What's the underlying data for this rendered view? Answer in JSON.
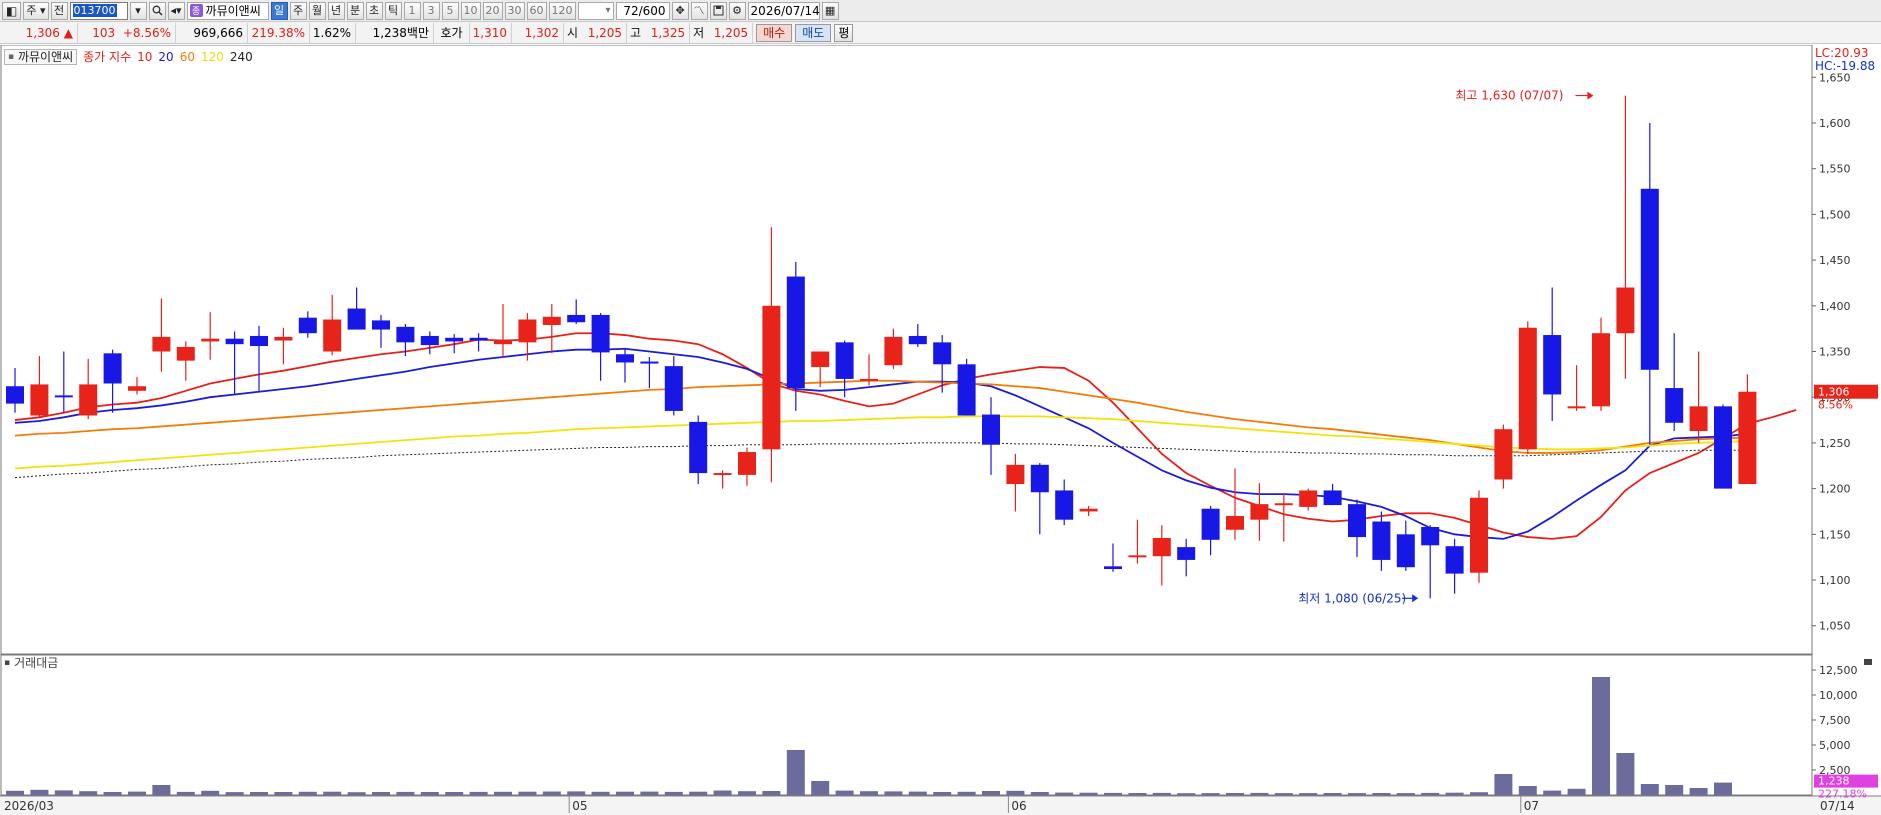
{
  "toolbar": {
    "market": "주",
    "jeon": "전",
    "stock_code": "013700",
    "stock_name": "까뮤이앤씨",
    "stock_badge": "종",
    "periods": [
      "일",
      "주",
      "월",
      "년",
      "분",
      "초",
      "틱"
    ],
    "active_period": "일",
    "intervals": [
      "1",
      "3",
      "5",
      "10",
      "20",
      "30",
      "60",
      "120"
    ],
    "count": "72",
    "count_total": "/600",
    "date": "2026/07/14"
  },
  "quote": {
    "price": "1,306",
    "change_arrow": "▲",
    "change": "103",
    "change_pct": "+8.56%",
    "volume": "969,666",
    "volume_ratio": "219.38%",
    "turnover": "1.62%",
    "amount": "1,238백만",
    "bid_label": "호가",
    "ask_price": "1,310",
    "bid_price": "1,302",
    "open_label": "시",
    "open": "1,205",
    "high_label": "고",
    "high": "1,325",
    "low_label": "저",
    "low": "1,205",
    "buy_label": "매수",
    "sell_label": "매도",
    "eval_label": "평"
  },
  "legend": {
    "name": "까뮤이앤씨",
    "ma_label": "종가 지수",
    "ma_periods": [
      "10",
      "20",
      "60",
      "120",
      "240"
    ],
    "ma_colors": [
      "#e8201a",
      "#1c1cd6",
      "#f07d0a",
      "#f2e30c",
      "#222222"
    ],
    "volume_label": "거래대금"
  },
  "colors": {
    "up": "#e8231a",
    "down": "#1717e6",
    "volume": "#6c6c9c",
    "price_tag": "#e8231a",
    "volume_tag": "#e040e0"
  },
  "chart_data": {
    "type": "candlestick",
    "x_tick_labels": [
      "2026/03",
      "05",
      "06",
      "07",
      "07/14"
    ],
    "y_ticks": [
      "1,650",
      "1,600",
      "1,550",
      "1,500",
      "1,450",
      "1,400",
      "1,350",
      "1,300",
      "1,250",
      "1,200",
      "1,150",
      "1,100",
      "1,050"
    ],
    "y_range": [
      1030,
      1670
    ],
    "volume_ticks": [
      "12,500",
      "10,000",
      "7,500",
      "5,000",
      "2,500"
    ],
    "volume_range": [
      0,
      13000
    ],
    "lc_label": "LC:20.93",
    "hc_label": "HC:-19.88",
    "high_annotation": "최고 1,630 (07/07)",
    "low_annotation": "최저 1,080 (06/25)",
    "current_price_tag": "1,306",
    "current_change_tag": "8.56%",
    "volume_tag": "1,238",
    "volume_pct_tag": "227.18%",
    "candles": [
      {
        "o": 1312,
        "h": 1332,
        "l": 1283,
        "c": 1293
      },
      {
        "o": 1280,
        "h": 1345,
        "l": 1277,
        "c": 1314
      },
      {
        "o": 1302,
        "h": 1350,
        "l": 1283,
        "c": 1300
      },
      {
        "o": 1280,
        "h": 1342,
        "l": 1276,
        "c": 1314
      },
      {
        "o": 1348,
        "h": 1352,
        "l": 1283,
        "c": 1315
      },
      {
        "o": 1307,
        "h": 1322,
        "l": 1303,
        "c": 1312
      },
      {
        "o": 1350,
        "h": 1408,
        "l": 1328,
        "c": 1366
      },
      {
        "o": 1340,
        "h": 1361,
        "l": 1318,
        "c": 1355
      },
      {
        "o": 1361,
        "h": 1393,
        "l": 1341,
        "c": 1364
      },
      {
        "o": 1364,
        "h": 1372,
        "l": 1303,
        "c": 1358
      },
      {
        "o": 1367,
        "h": 1378,
        "l": 1307,
        "c": 1356
      },
      {
        "o": 1362,
        "h": 1376,
        "l": 1336,
        "c": 1366
      },
      {
        "o": 1387,
        "h": 1394,
        "l": 1365,
        "c": 1370
      },
      {
        "o": 1350,
        "h": 1412,
        "l": 1346,
        "c": 1385
      },
      {
        "o": 1397,
        "h": 1420,
        "l": 1377,
        "c": 1374
      },
      {
        "o": 1384,
        "h": 1390,
        "l": 1354,
        "c": 1374
      },
      {
        "o": 1377,
        "h": 1380,
        "l": 1345,
        "c": 1360
      },
      {
        "o": 1367,
        "h": 1372,
        "l": 1347,
        "c": 1357
      },
      {
        "o": 1365,
        "h": 1369,
        "l": 1348,
        "c": 1361
      },
      {
        "o": 1365,
        "h": 1370,
        "l": 1350,
        "c": 1362
      },
      {
        "o": 1358,
        "h": 1402,
        "l": 1343,
        "c": 1362
      },
      {
        "o": 1360,
        "h": 1392,
        "l": 1340,
        "c": 1385
      },
      {
        "o": 1379,
        "h": 1402,
        "l": 1348,
        "c": 1388
      },
      {
        "o": 1390,
        "h": 1407,
        "l": 1380,
        "c": 1382
      },
      {
        "o": 1390,
        "h": 1392,
        "l": 1318,
        "c": 1349
      },
      {
        "o": 1347,
        "h": 1353,
        "l": 1316,
        "c": 1338
      },
      {
        "o": 1339,
        "h": 1344,
        "l": 1310,
        "c": 1338
      },
      {
        "o": 1334,
        "h": 1345,
        "l": 1280,
        "c": 1285
      },
      {
        "o": 1273,
        "h": 1280,
        "l": 1205,
        "c": 1217
      },
      {
        "o": 1217,
        "h": 1220,
        "l": 1200,
        "c": 1217
      },
      {
        "o": 1215,
        "h": 1245,
        "l": 1203,
        "c": 1240
      },
      {
        "o": 1243,
        "h": 1486,
        "l": 1207,
        "c": 1400
      },
      {
        "o": 1432,
        "h": 1448,
        "l": 1285,
        "c": 1310
      },
      {
        "o": 1333,
        "h": 1348,
        "l": 1311,
        "c": 1350
      },
      {
        "o": 1360,
        "h": 1362,
        "l": 1300,
        "c": 1320
      },
      {
        "o": 1318,
        "h": 1347,
        "l": 1313,
        "c": 1320
      },
      {
        "o": 1335,
        "h": 1375,
        "l": 1331,
        "c": 1366
      },
      {
        "o": 1367,
        "h": 1380,
        "l": 1355,
        "c": 1358
      },
      {
        "o": 1360,
        "h": 1368,
        "l": 1305,
        "c": 1336
      },
      {
        "o": 1336,
        "h": 1342,
        "l": 1280,
        "c": 1280
      },
      {
        "o": 1281,
        "h": 1300,
        "l": 1215,
        "c": 1248
      },
      {
        "o": 1205,
        "h": 1238,
        "l": 1175,
        "c": 1226
      },
      {
        "o": 1226,
        "h": 1228,
        "l": 1150,
        "c": 1196
      },
      {
        "o": 1198,
        "h": 1210,
        "l": 1160,
        "c": 1166
      },
      {
        "o": 1175,
        "h": 1181,
        "l": 1170,
        "c": 1178
      },
      {
        "o": 1115,
        "h": 1140,
        "l": 1109,
        "c": 1112
      },
      {
        "o": 1125,
        "h": 1166,
        "l": 1118,
        "c": 1127
      },
      {
        "o": 1126,
        "h": 1160,
        "l": 1094,
        "c": 1146
      },
      {
        "o": 1136,
        "h": 1145,
        "l": 1104,
        "c": 1122
      },
      {
        "o": 1178,
        "h": 1181,
        "l": 1127,
        "c": 1144
      },
      {
        "o": 1155,
        "h": 1222,
        "l": 1144,
        "c": 1170
      },
      {
        "o": 1166,
        "h": 1206,
        "l": 1143,
        "c": 1183
      },
      {
        "o": 1183,
        "h": 1195,
        "l": 1142,
        "c": 1184
      },
      {
        "o": 1180,
        "h": 1200,
        "l": 1176,
        "c": 1198
      },
      {
        "o": 1198,
        "h": 1205,
        "l": 1183,
        "c": 1182
      },
      {
        "o": 1183,
        "h": 1188,
        "l": 1125,
        "c": 1147
      },
      {
        "o": 1164,
        "h": 1175,
        "l": 1110,
        "c": 1122
      },
      {
        "o": 1150,
        "h": 1165,
        "l": 1110,
        "c": 1114
      },
      {
        "o": 1158,
        "h": 1160,
        "l": 1080,
        "c": 1138
      },
      {
        "o": 1137,
        "h": 1145,
        "l": 1085,
        "c": 1107
      },
      {
        "o": 1108,
        "h": 1198,
        "l": 1097,
        "c": 1190
      },
      {
        "o": 1210,
        "h": 1270,
        "l": 1200,
        "c": 1265
      },
      {
        "o": 1243,
        "h": 1383,
        "l": 1238,
        "c": 1376
      },
      {
        "o": 1368,
        "h": 1420,
        "l": 1274,
        "c": 1303
      },
      {
        "o": 1290,
        "h": 1335,
        "l": 1285,
        "c": 1290
      },
      {
        "o": 1290,
        "h": 1387,
        "l": 1285,
        "c": 1370
      },
      {
        "o": 1370,
        "h": 1630,
        "l": 1320,
        "c": 1420
      },
      {
        "o": 1528,
        "h": 1600,
        "l": 1248,
        "c": 1330
      },
      {
        "o": 1310,
        "h": 1370,
        "l": 1263,
        "c": 1272
      },
      {
        "o": 1263,
        "h": 1350,
        "l": 1250,
        "c": 1290
      },
      {
        "o": 1290,
        "h": 1292,
        "l": 1200,
        "c": 1200
      },
      {
        "o": 1205,
        "h": 1325,
        "l": 1205,
        "c": 1306
      }
    ],
    "volume": [
      420,
      520,
      460,
      380,
      300,
      340,
      1000,
      310,
      420,
      290,
      300,
      300,
      320,
      330,
      280,
      300,
      310,
      300,
      300,
      310,
      320,
      330,
      350,
      360,
      320,
      330,
      340,
      310,
      330,
      450,
      380,
      400,
      4500,
      1400,
      440,
      380,
      360,
      340,
      300,
      320,
      400,
      420,
      300,
      240,
      230,
      210,
      200,
      210,
      180,
      190,
      200,
      210,
      190,
      190,
      200,
      190,
      200,
      190,
      210,
      230,
      280,
      2100,
      900,
      440,
      620,
      11800,
      4200,
      1100,
      1000,
      700,
      1238
    ],
    "ma_series": [
      {
        "name": "10",
        "values": [
          1275,
          1278,
          1283,
          1289,
          1292,
          1294,
          1299,
          1307,
          1315,
          1320,
          1325,
          1329,
          1334,
          1339,
          1343,
          1347,
          1350,
          1354,
          1358,
          1363,
          1362,
          1363,
          1366,
          1370,
          1370,
          1368,
          1364,
          1362,
          1358,
          1347,
          1332,
          1315,
          1307,
          1303,
          1296,
          1290,
          1293,
          1303,
          1313,
          1320,
          1325,
          1329,
          1333,
          1332,
          1318,
          1294,
          1266,
          1238,
          1217,
          1203,
          1190,
          1181,
          1172,
          1167,
          1164,
          1166,
          1170,
          1173,
          1173,
          1168,
          1160,
          1152,
          1147,
          1145,
          1148,
          1169,
          1198,
          1217,
          1228,
          1239,
          1255,
          1271,
          1278,
          1286
        ]
      },
      {
        "name": "20",
        "values": [
          1272,
          1274,
          1278,
          1283,
          1286,
          1288,
          1291,
          1295,
          1300,
          1303,
          1306,
          1309,
          1312,
          1316,
          1320,
          1324,
          1328,
          1333,
          1337,
          1341,
          1344,
          1347,
          1350,
          1352,
          1352,
          1353,
          1350,
          1347,
          1344,
          1338,
          1331,
          1320,
          1309,
          1307,
          1308,
          1311,
          1314,
          1317,
          1317,
          1316,
          1312,
          1302,
          1290,
          1278,
          1266,
          1250,
          1235,
          1220,
          1209,
          1201,
          1196,
          1194,
          1194,
          1193,
          1191,
          1186,
          1180,
          1170,
          1157,
          1150,
          1147,
          1145,
          1153,
          1169,
          1187,
          1204,
          1220,
          1247,
          1255,
          1256,
          1257,
          1260
        ]
      },
      {
        "name": "60",
        "values": [
          1258,
          1260,
          1261,
          1263,
          1265,
          1266,
          1268,
          1270,
          1272,
          1274,
          1276,
          1278,
          1280,
          1282,
          1284,
          1286,
          1288,
          1290,
          1292,
          1294,
          1296,
          1298,
          1300,
          1302,
          1304,
          1306,
          1308,
          1309,
          1311,
          1312,
          1313,
          1314,
          1315,
          1316,
          1317,
          1318,
          1318,
          1317,
          1316,
          1315,
          1314,
          1312,
          1310,
          1306,
          1302,
          1298,
          1294,
          1289,
          1284,
          1280,
          1276,
          1273,
          1270,
          1267,
          1265,
          1262,
          1259,
          1256,
          1253,
          1249,
          1245,
          1241,
          1239,
          1239,
          1240,
          1242,
          1246,
          1250,
          1252,
          1254,
          1255,
          1256
        ]
      },
      {
        "name": "120",
        "values": [
          1222,
          1224,
          1225,
          1227,
          1229,
          1231,
          1233,
          1235,
          1237,
          1239,
          1241,
          1243,
          1245,
          1247,
          1249,
          1251,
          1253,
          1255,
          1257,
          1258,
          1260,
          1261,
          1263,
          1265,
          1266,
          1267,
          1268,
          1269,
          1270,
          1271,
          1272,
          1273,
          1274,
          1274,
          1275,
          1276,
          1277,
          1278,
          1278,
          1279,
          1279,
          1279,
          1279,
          1278,
          1277,
          1276,
          1274,
          1272,
          1270,
          1268,
          1266,
          1264,
          1262,
          1260,
          1258,
          1257,
          1255,
          1253,
          1251,
          1249,
          1247,
          1245,
          1244,
          1243,
          1243,
          1244,
          1245,
          1247,
          1249,
          1250,
          1251,
          1252
        ]
      },
      {
        "name": "240",
        "values": [
          1212,
          1214,
          1216,
          1217,
          1219,
          1221,
          1222,
          1224,
          1226,
          1227,
          1229,
          1230,
          1232,
          1233,
          1234,
          1236,
          1237,
          1238,
          1239,
          1240,
          1241,
          1242,
          1243,
          1244,
          1245,
          1245,
          1246,
          1246,
          1247,
          1247,
          1248,
          1248,
          1248,
          1249,
          1249,
          1249,
          1249,
          1250,
          1250,
          1250,
          1250,
          1249,
          1249,
          1248,
          1247,
          1246,
          1245,
          1244,
          1243,
          1242,
          1241,
          1240,
          1240,
          1239,
          1239,
          1238,
          1238,
          1237,
          1237,
          1236,
          1236,
          1236,
          1236,
          1237,
          1238,
          1239,
          1240,
          1241,
          1241,
          1242,
          1242,
          1242
        ]
      }
    ]
  }
}
